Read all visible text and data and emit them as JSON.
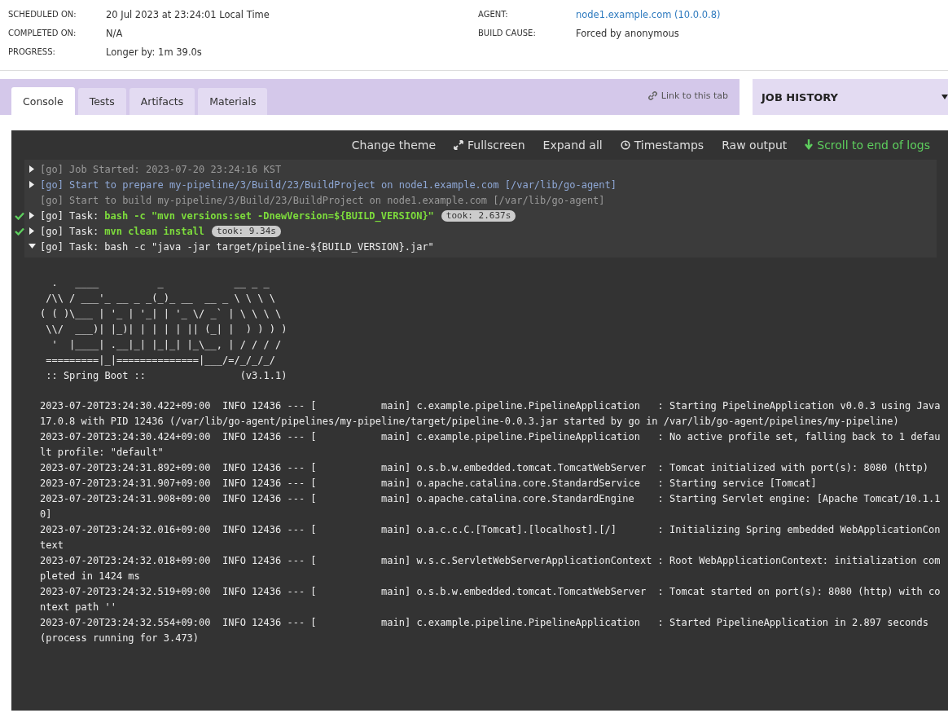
{
  "summary": {
    "left": [
      {
        "label": "SCHEDULED ON:",
        "value": "20 Jul 2023 at 23:24:01 Local Time"
      },
      {
        "label": "COMPLETED ON:",
        "value": "N/A"
      },
      {
        "label": "PROGRESS:",
        "value": "Longer by: 1m 39.0s"
      }
    ],
    "right": [
      {
        "label": "AGENT:",
        "value": "node1.example.com (10.0.0.8)",
        "kind": "link"
      },
      {
        "label": "BUILD CAUSE:",
        "value": "Forced by anonymous",
        "kind": "text"
      }
    ]
  },
  "tabs": [
    {
      "label": "Console",
      "selected": true
    },
    {
      "label": "Tests",
      "selected": false
    },
    {
      "label": "Artifacts",
      "selected": false
    },
    {
      "label": "Materials",
      "selected": false
    }
  ],
  "link_to_tab": "Link to this tab",
  "job_history": {
    "title": "JOB HISTORY"
  },
  "toolbar": [
    {
      "label": "Change theme",
      "kind": "plain",
      "accent": false
    },
    {
      "label": "Fullscreen",
      "kind": "fullscreen",
      "accent": false
    },
    {
      "label": "Expand all",
      "kind": "plain",
      "accent": false
    },
    {
      "label": "Timestamps",
      "kind": "timestamps",
      "accent": false
    },
    {
      "label": "Raw output",
      "kind": "plain",
      "accent": false
    },
    {
      "label": "Scroll to end of logs",
      "kind": "scroll",
      "accent": true
    }
  ],
  "sections": [
    {
      "kind": "info",
      "expanded": false,
      "text": "[go] Job Started: 2023-07-20 23:24:16 KST"
    },
    {
      "kind": "prepare",
      "expanded": false,
      "text": "[go] Start to prepare my-pipeline/3/Build/23/BuildProject on node1.example.com [/var/lib/go-agent]"
    },
    {
      "kind": "info",
      "text": "[go] Start to build my-pipeline/3/Build/23/BuildProject on node1.example.com [/var/lib/go-agent]"
    },
    {
      "kind": "task",
      "passed": true,
      "expanded": false,
      "label": "[go] Task:",
      "command": "bash -c \"mvn versions:set -DnewVersion=${BUILD_VERSION}\"",
      "took": "took: 2.637s"
    },
    {
      "kind": "task",
      "passed": true,
      "expanded": false,
      "label": "[go] Task:",
      "command": "mvn clean install",
      "took": "took: 9.34s"
    },
    {
      "kind": "task",
      "passed": false,
      "expanded": true,
      "label": "[go] Task:",
      "command": "bash -c \"java -jar target/pipeline-${BUILD_VERSION}.jar\""
    }
  ],
  "banner": [
    "  .   ____          _            __ _ _",
    " /\\\\ / ___'_ __ _ _(_)_ __  __ _ \\ \\ \\ \\",
    "( ( )\\___ | '_ | '_| | '_ \\/ _` | \\ \\ \\ \\",
    " \\\\/  ___)| |_)| | | | | || (_| |  ) ) ) )",
    "  '  |____| .__|_| |_|_| |_\\__, | / / / /",
    " =========|_|==============|___/=/_/_/_/",
    " :: Spring Boot ::                (v3.1.1)"
  ],
  "log": [
    "2023-07-20T23:24:30.422+09:00  INFO 12436 --- [           main] c.example.pipeline.PipelineApplication   : Starting PipelineApplication v0.0.3 using Java 17.0.8 with PID 12436 (/var/lib/go-agent/pipelines/my-pipeline/target/pipeline-0.0.3.jar started by go in /var/lib/go-agent/pipelines/my-pipeline)",
    "2023-07-20T23:24:30.424+09:00  INFO 12436 --- [           main] c.example.pipeline.PipelineApplication   : No active profile set, falling back to 1 default profile: \"default\"",
    "2023-07-20T23:24:31.892+09:00  INFO 12436 --- [           main] o.s.b.w.embedded.tomcat.TomcatWebServer  : Tomcat initialized with port(s): 8080 (http)",
    "2023-07-20T23:24:31.907+09:00  INFO 12436 --- [           main] o.apache.catalina.core.StandardService   : Starting service [Tomcat]",
    "2023-07-20T23:24:31.908+09:00  INFO 12436 --- [           main] o.apache.catalina.core.StandardEngine    : Starting Servlet engine: [Apache Tomcat/10.1.10]",
    "2023-07-20T23:24:32.016+09:00  INFO 12436 --- [           main] o.a.c.c.C.[Tomcat].[localhost].[/]       : Initializing Spring embedded WebApplicationContext",
    "2023-07-20T23:24:32.018+09:00  INFO 12436 --- [           main] w.s.c.ServletWebServerApplicationContext : Root WebApplicationContext: initialization completed in 1424 ms",
    "2023-07-20T23:24:32.519+09:00  INFO 12436 --- [           main] o.s.b.w.embedded.tomcat.TomcatWebServer  : Tomcat started on port(s): 8080 (http) with context path ''",
    "2023-07-20T23:24:32.554+09:00  INFO 12436 --- [           main] c.example.pipeline.PipelineApplication   : Started PipelineApplication in 2.897 seconds (process running for 3.473)"
  ]
}
